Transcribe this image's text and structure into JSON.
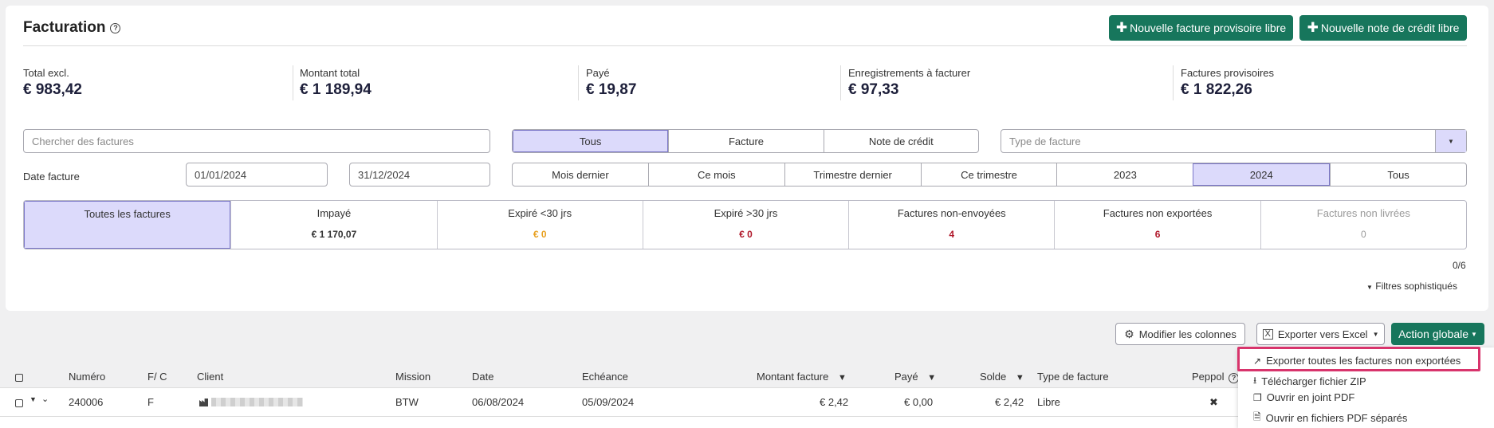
{
  "header": {
    "title": "Facturation",
    "new_invoice_button": "Nouvelle facture provisoire libre",
    "new_credit_note_button": "Nouvelle note de crédit libre"
  },
  "stats": [
    {
      "label": "Total excl.",
      "value": "€ 983,42"
    },
    {
      "label": "Montant total",
      "value": "€ 1 189,94"
    },
    {
      "label": "Payé",
      "value": "€ 19,87"
    },
    {
      "label": "Enregistrements à facturer",
      "value": "€ 97,33"
    },
    {
      "label": "Factures provisoires",
      "value": "€ 1 822,26"
    }
  ],
  "filters": {
    "search_placeholder": "Chercher des factures",
    "type_tabs": [
      "Tous",
      "Facture",
      "Note de crédit"
    ],
    "type_tabs_active": "Tous",
    "invoice_type_placeholder": "Type de facture",
    "date_label": "Date facture",
    "date_from": "01/01/2024",
    "date_to": "31/12/2024",
    "period_tabs": [
      "Mois dernier",
      "Ce mois",
      "Trimestre dernier",
      "Ce trimestre",
      "2023",
      "2024",
      "Tous"
    ],
    "period_active": "2024"
  },
  "tiles": [
    {
      "label": "Toutes les factures",
      "value": "",
      "active": true
    },
    {
      "label": "Impayé",
      "value": "€ 1 170,07"
    },
    {
      "label": "Expiré <30 jrs",
      "value": "€ 0"
    },
    {
      "label": "Expiré >30 jrs",
      "value": "€ 0"
    },
    {
      "label": "Factures non-envoyées",
      "value": "4"
    },
    {
      "label": "Factures non exportées",
      "value": "6"
    },
    {
      "label": "Factures non livrées",
      "value": "0"
    }
  ],
  "colors": {
    "green": "#17765c",
    "orange": "#e8a020",
    "red": "#b0182a",
    "active_tab": "#dcdafb",
    "highlight": "#d8346c"
  },
  "selection_count": "0/6",
  "advanced_filters": "Filtres sophistiqués",
  "toolbar": {
    "columns_button": "Modifier les colonnes",
    "excel_button": "Exporter vers Excel",
    "global_action_button": "Action globale"
  },
  "table": {
    "headers": [
      "Numéro",
      "F/ C",
      "Client",
      "Mission",
      "Date",
      "Echéance",
      "Montant facture",
      "Payé",
      "Solde",
      "Type de facture",
      "Peppol"
    ],
    "rows": [
      {
        "numero": "240006",
        "fc": "F",
        "client": "",
        "mission": "BTW",
        "date": "06/08/2024",
        "echeance": "05/09/2024",
        "montant": "€ 2,42",
        "paye": "€ 0,00",
        "solde": "€ 2,42",
        "type": "Libre",
        "peppol": "✖"
      }
    ]
  },
  "dropdown": {
    "items": [
      "Exporter toutes les factures non exportées",
      "Télécharger fichier ZIP",
      "Ouvrir en joint PDF",
      "Ouvrir en fichiers PDF séparés"
    ]
  }
}
